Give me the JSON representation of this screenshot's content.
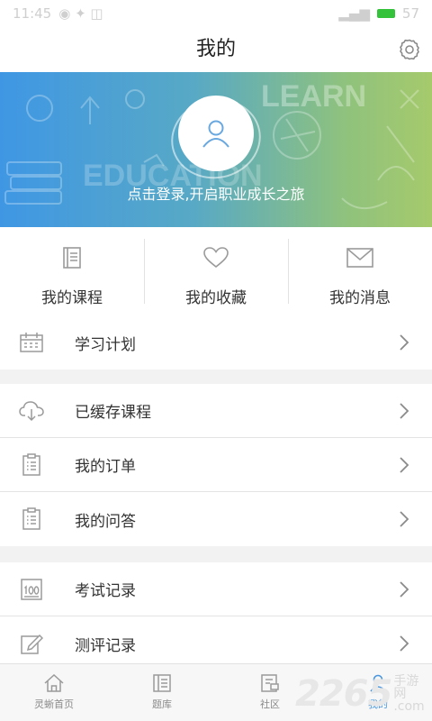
{
  "status_bar": {
    "time": "11:45",
    "battery": "57"
  },
  "header": {
    "title": "我的"
  },
  "banner": {
    "login_text": "点击登录,开启职业成长之旅",
    "decor_words": [
      "LEARN",
      "EDUCATION"
    ]
  },
  "quick_actions": [
    {
      "label": "我的课程",
      "icon": "book-icon"
    },
    {
      "label": "我的收藏",
      "icon": "heart-icon"
    },
    {
      "label": "我的消息",
      "icon": "envelope-icon"
    }
  ],
  "menu_groups": [
    [
      {
        "label": "学习计划",
        "icon": "calendar-icon"
      }
    ],
    [
      {
        "label": "已缓存课程",
        "icon": "cloud-download-icon"
      },
      {
        "label": "我的订单",
        "icon": "clipboard-list-icon"
      },
      {
        "label": "我的问答",
        "icon": "clipboard-list-icon"
      }
    ],
    [
      {
        "label": "考试记录",
        "icon": "score-100-icon"
      },
      {
        "label": "测评记录",
        "icon": "edit-note-icon"
      }
    ]
  ],
  "tabs": [
    {
      "label": "灵蜥首页",
      "icon": "home-icon",
      "active": false
    },
    {
      "label": "题库",
      "icon": "question-bank-icon",
      "active": false
    },
    {
      "label": "社区",
      "icon": "community-icon",
      "active": false
    },
    {
      "label": "我的",
      "icon": "profile-icon",
      "active": true
    }
  ],
  "watermark": {
    "number": "2265",
    "sub1": "手游网",
    "sub2": ".com"
  },
  "colors": {
    "accent": "#4a97e0",
    "banner_start": "#3f97e4",
    "banner_end": "#a6ca6c",
    "icon_gray": "#9a9a9a"
  }
}
